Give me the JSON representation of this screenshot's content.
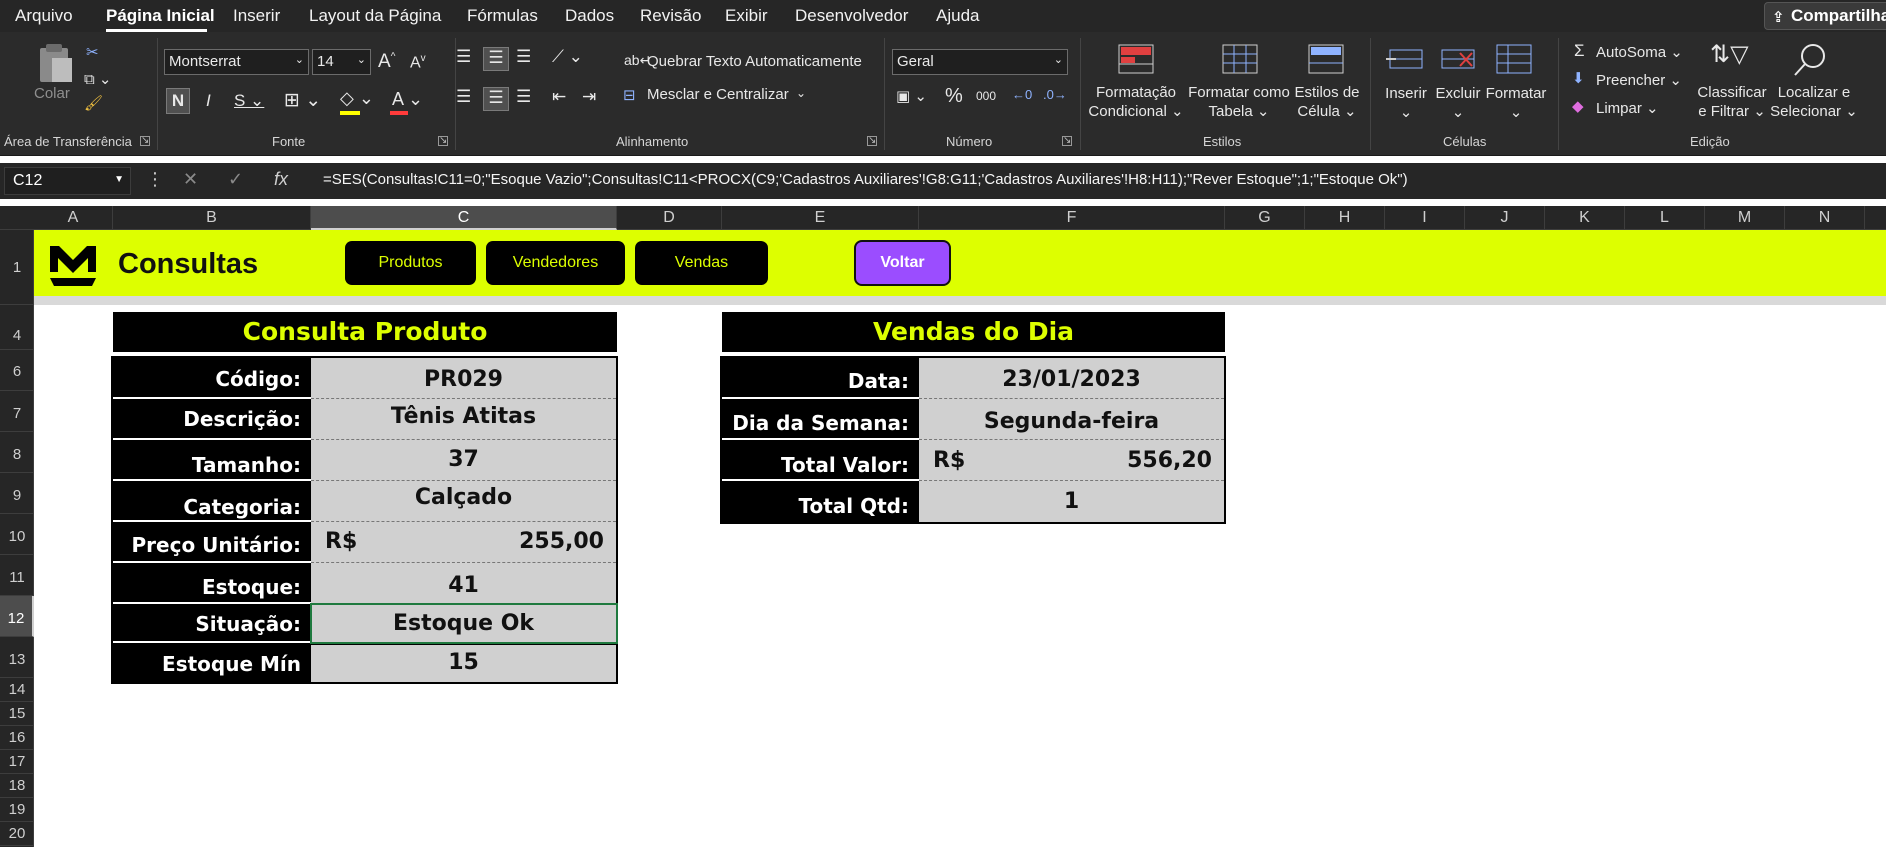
{
  "menu": {
    "tabs": [
      "Arquivo",
      "Página Inicial",
      "Inserir",
      "Layout da Página",
      "Fórmulas",
      "Dados",
      "Revisão",
      "Exibir",
      "Desenvolvedor",
      "Ajuda"
    ],
    "active": "Página Inicial",
    "share": "Compartilhar"
  },
  "ribbon": {
    "clipboard": {
      "paste": "Colar",
      "label": "Área de Transferência"
    },
    "font": {
      "family": "Montserrat",
      "size": "14",
      "label": "Fonte"
    },
    "alignment": {
      "wrap": "Quebrar Texto Automaticamente",
      "merge": "Mesclar e Centralizar",
      "label": "Alinhamento"
    },
    "number": {
      "format": "Geral",
      "label": "Número",
      "thousands": "000"
    },
    "styles": {
      "conditional": [
        "Formatação",
        "Condicional"
      ],
      "table": [
        "Formatar como",
        "Tabela"
      ],
      "cell": [
        "Estilos de",
        "Célula"
      ],
      "label": "Estilos"
    },
    "cells": {
      "insert": "Inserir",
      "delete": "Excluir",
      "format": "Formatar",
      "label": "Células"
    },
    "editing": {
      "autosum": "AutoSoma",
      "fill": "Preencher",
      "clear": "Limpar",
      "sort": [
        "Classificar",
        "e Filtrar"
      ],
      "find": [
        "Localizar e",
        "Selecionar"
      ],
      "label": "Edição"
    }
  },
  "formula_bar": {
    "name_box": "C12",
    "formula": "=SES(Consultas!C11=0;\"Esoque Vazio\";Consultas!C11<PROCX(C9;'Cadastros Auxiliares'!G8:G11;'Cadastros Auxiliares'!H8:H11);\"Rever Estoque\";1;\"Estoque Ok\")"
  },
  "grid": {
    "columns": [
      "A",
      "B",
      "C",
      "D",
      "E",
      "F",
      "G",
      "H",
      "I",
      "J",
      "K",
      "L",
      "M",
      "N"
    ],
    "rows": [
      "1",
      "4",
      "6",
      "7",
      "8",
      "9",
      "10",
      "11",
      "12",
      "13",
      "14",
      "15",
      "16",
      "17",
      "18",
      "19",
      "20"
    ],
    "selected_column": "C",
    "selected_row": "12"
  },
  "sheet": {
    "title": "Consultas",
    "buttons": {
      "produtos": "Produtos",
      "vendedores": "Vendedores",
      "vendas": "Vendas",
      "voltar": "Voltar"
    },
    "brand_color": "#ddff00",
    "accent_color": "#9b4dff"
  },
  "consulta_produto": {
    "title": "Consulta Produto",
    "rows": [
      {
        "label": "Código:",
        "value": "PR029"
      },
      {
        "label": "Descrição:",
        "value": "Tênis Atitas"
      },
      {
        "label": "Tamanho:",
        "value": "37"
      },
      {
        "label": "Categoria:",
        "value": "Calçado"
      },
      {
        "label": "Preço Unitário:",
        "currency": "R$",
        "value": "255,00"
      },
      {
        "label": "Estoque:",
        "value": "41"
      },
      {
        "label": "Situação:",
        "value": "Estoque Ok"
      },
      {
        "label": "Estoque Mín",
        "value": "15"
      }
    ]
  },
  "vendas_dia": {
    "title": "Vendas do Dia",
    "rows": [
      {
        "label": "Data:",
        "value": "23/01/2023"
      },
      {
        "label": "Dia da Semana:",
        "value": "Segunda-feira"
      },
      {
        "label": "Total Valor:",
        "currency": "R$",
        "value": "556,20"
      },
      {
        "label": "Total Qtd:",
        "value": "1"
      }
    ]
  }
}
